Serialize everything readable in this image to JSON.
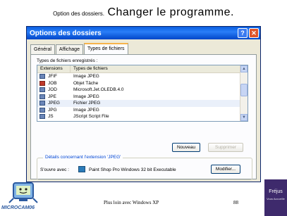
{
  "slide": {
    "title_small": "Option des dossiers.",
    "title_big": "Changer le programme.",
    "footer_text": "Plus loin avec Windows XP",
    "page_number": "88",
    "corner_brand": "MICROCAM06",
    "side_brand": "Fréjus",
    "side_brand_sub": "Vous Accueille"
  },
  "window": {
    "title": "Options des dossiers",
    "help_button": "?",
    "close_button": "✕",
    "tabs": [
      {
        "label": "Général",
        "active": false
      },
      {
        "label": "Affichage",
        "active": false
      },
      {
        "label": "Types de fichiers",
        "active": true
      }
    ],
    "registered_label": "Types de fichiers enregistrés :",
    "columns": {
      "extension": "Extensions",
      "type": "Types de fichiers"
    },
    "rows": [
      {
        "ext": "JFIF",
        "type": "Image JPEG",
        "icon": "jpeg-file-icon"
      },
      {
        "ext": "JOB",
        "type": "Objet Tâche",
        "icon": "job-file-icon"
      },
      {
        "ext": "JOD",
        "type": "Microsoft.Jet.OLEDB.4.0",
        "icon": "jod-file-icon"
      },
      {
        "ext": "JPE",
        "type": "Image JPEG",
        "icon": "jpeg-file-icon"
      },
      {
        "ext": "JPEG",
        "type": "Fichier JPEG",
        "icon": "jpeg-file-icon",
        "selected": true
      },
      {
        "ext": "JPG",
        "type": "Image JPEG",
        "icon": "jpeg-file-icon"
      },
      {
        "ext": "JS",
        "type": "JScript Script File",
        "icon": "js-file-icon"
      }
    ],
    "new_button": "Nouveau",
    "delete_button": "Supprimer",
    "details_label": "Détails concernant l'extension 'JPEG'",
    "opens_with_label": "S'ouvre avec :",
    "opens_with_app": "Paint Shop Pro Windows 32 bit Executable",
    "modify_button": "Modifier..."
  }
}
